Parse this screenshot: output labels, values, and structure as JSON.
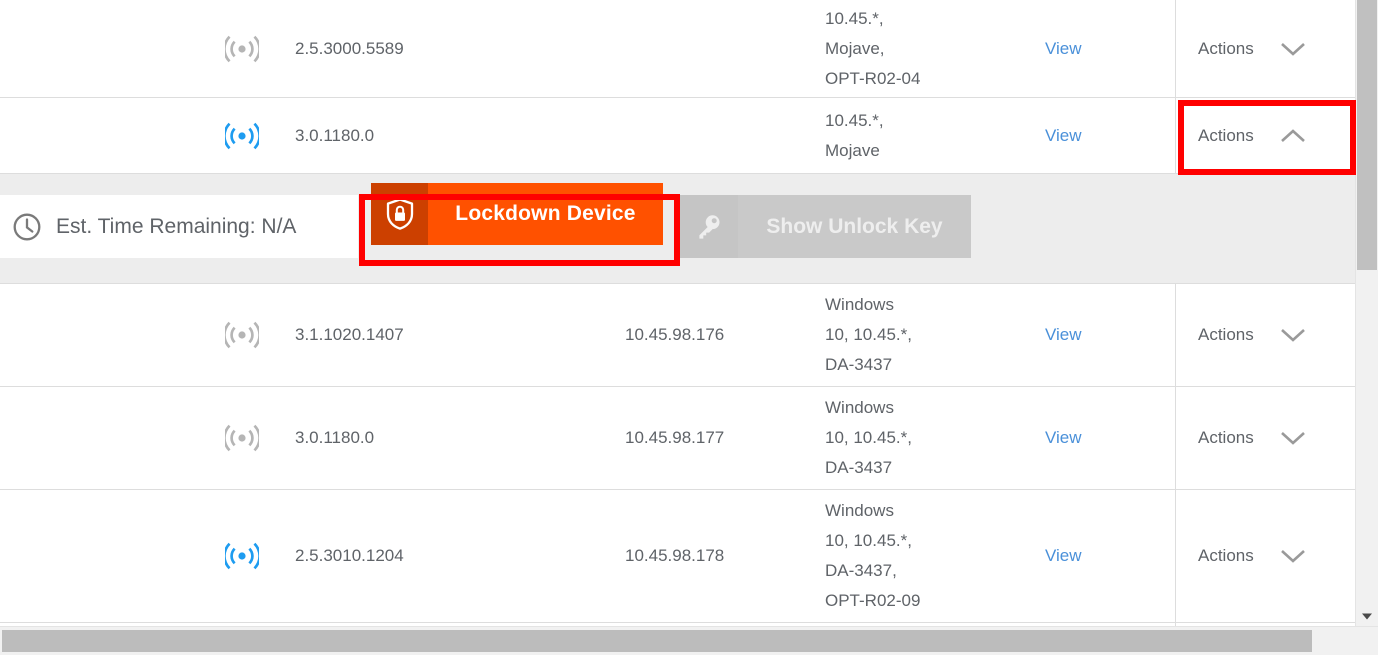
{
  "table": {
    "rows": [
      {
        "signal_icon": "broadcast-icon",
        "signal_state": "off",
        "version": "2.5.3000.5589",
        "ip": "",
        "os": "10.45.*,\nMojave,\nOPT-R02-04",
        "view_label": "View",
        "actions_label": "Actions",
        "chevron": "chevron-down-icon"
      },
      {
        "signal_icon": "broadcast-icon",
        "signal_state": "on",
        "version": "3.0.1180.0",
        "ip": "",
        "os": "10.45.*,\nMojave",
        "view_label": "View",
        "actions_label": "Actions",
        "chevron": "chevron-up-icon"
      },
      {
        "signal_icon": "broadcast-icon",
        "signal_state": "off",
        "version": "3.1.1020.1407",
        "ip": "10.45.98.176",
        "os": "Windows\n10, 10.45.*,\nDA-3437",
        "view_label": "View",
        "actions_label": "Actions",
        "chevron": "chevron-down-icon"
      },
      {
        "signal_icon": "broadcast-icon",
        "signal_state": "off",
        "version": "3.0.1180.0",
        "ip": "10.45.98.177",
        "os": "Windows\n10, 10.45.*,\nDA-3437",
        "view_label": "View",
        "actions_label": "Actions",
        "chevron": "chevron-down-icon"
      },
      {
        "signal_icon": "broadcast-icon",
        "signal_state": "on",
        "version": "2.5.3010.1204",
        "ip": "10.45.98.178",
        "os": "Windows\n10, 10.45.*,\nDA-3437,\nOPT-R02-09",
        "view_label": "View",
        "actions_label": "Actions",
        "chevron": "chevron-down-icon"
      }
    ]
  },
  "lockdown_panel": {
    "clock_icon": "clock-icon",
    "est_time_label": "Est. Time Remaining: N/A",
    "lockdown_button": {
      "label": "Lockdown Device",
      "icon": "shield-lock-icon",
      "color": "#ff5100",
      "icon_box_color": "#cc4000"
    },
    "unlock_button": {
      "label": "Show Unlock Key",
      "icon": "key-icon",
      "disabled": true,
      "color": "#c9c9c9"
    }
  },
  "annotations": {
    "actions_highlight": "actions-cell-highlight",
    "lockdown_highlight": "lockdown-button-highlight",
    "highlight_color": "#ff0000"
  },
  "scrollbars": {
    "vertical_arrow": "arrow-down-icon",
    "horizontal_arrow": "arrow-right-icon"
  },
  "colors": {
    "link": "#4a90d9",
    "signal_on": "#1e9cf0",
    "signal_off": "#b5b5b5",
    "text": "#5f6368"
  }
}
